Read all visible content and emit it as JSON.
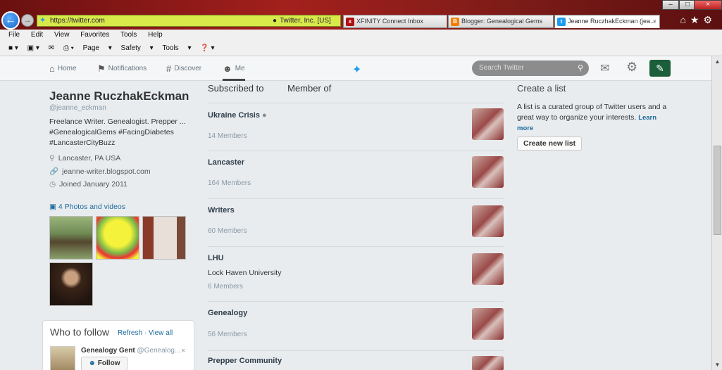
{
  "browser": {
    "address": "https://twitter.com",
    "site_owner": "Twitter, Inc. [US]",
    "tabs": [
      {
        "label": "XFINITY Connect Inbox",
        "icon": "xfinity-icon"
      },
      {
        "label": "Blogger: Genealogical Gems",
        "icon": "blogger-icon"
      },
      {
        "label": "Jeanne RuczhakEckman (jea...",
        "icon": "twitter-icon"
      }
    ],
    "menu": [
      "File",
      "Edit",
      "View",
      "Favorites",
      "Tools",
      "Help"
    ],
    "commands": [
      "Page",
      "Safety",
      "Tools"
    ]
  },
  "nav": {
    "home": "Home",
    "notifications": "Notifications",
    "discover": "Discover",
    "me": "Me",
    "search_placeholder": "Search Twitter"
  },
  "profile": {
    "name": "Jeanne RuczhakEckman",
    "handle": "@jeanne_eckman",
    "bio": "Freelance Writer. Genealogist. Prepper ... #GenealogicalGems #FacingDiabetes #LancasterCityBuzz",
    "location": "Lancaster, PA USA",
    "website": "jeanne-writer.blogspot.com",
    "joined": "Joined January 2011",
    "photos_label": "4 Photos and videos"
  },
  "who_to_follow": {
    "title": "Who to follow",
    "refresh": "Refresh",
    "view_all": "View all",
    "suggestion_name": "Genealogy Gent",
    "suggestion_handle": "@Genealog...",
    "follow_label": "Follow"
  },
  "lists_tabs": {
    "subscribed": "Subscribed to",
    "member": "Member of"
  },
  "lists": [
    {
      "title": "Ukraine Crisis",
      "locked": true,
      "description": "",
      "members": "14 Members"
    },
    {
      "title": "Lancaster",
      "locked": false,
      "description": "",
      "members": "164 Members"
    },
    {
      "title": "Writers",
      "locked": false,
      "description": "",
      "members": "60 Members"
    },
    {
      "title": "LHU",
      "locked": false,
      "description": "Lock Haven University",
      "members": "6 Members"
    },
    {
      "title": "Genealogy",
      "locked": false,
      "description": "",
      "members": "56 Members"
    },
    {
      "title": "Prepper Community",
      "locked": false,
      "description": "",
      "members": ""
    }
  ],
  "create_list": {
    "title": "Create a list",
    "text": "A list is a curated group of Twitter users and a great way to organize your interests.",
    "learn_more": "Learn more",
    "button": "Create new list"
  }
}
